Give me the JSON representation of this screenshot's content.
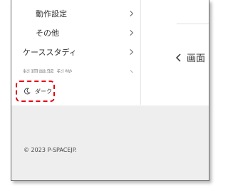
{
  "sidebar": {
    "items": [
      {
        "label": "動作設定"
      },
      {
        "label": "その他"
      },
      {
        "label": "ケーススタディ"
      },
      {
        "label": "料理機器 科学"
      }
    ]
  },
  "theme_toggle": {
    "label": "ダーク",
    "icon": "moon-icon"
  },
  "main": {
    "back_label": "画面"
  },
  "footer": {
    "copyright": "© 2023 P-SPACEJP."
  },
  "colors": {
    "highlight": "#e60012",
    "footer_bg": "#eeeeee",
    "text": "#333333"
  }
}
